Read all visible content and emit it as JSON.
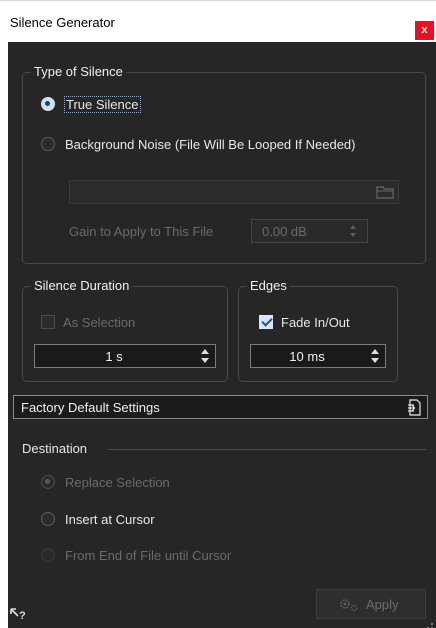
{
  "window": {
    "title": "Silence Generator",
    "close_label": "x"
  },
  "type_of_silence": {
    "legend": "Type of Silence",
    "true_silence": "True Silence",
    "background_noise": "Background Noise (File Will Be Looped If Needed)",
    "file_path": "",
    "gain_label": "Gain to Apply to This File",
    "gain_value": "0.00 dB"
  },
  "silence_duration": {
    "legend": "Silence Duration",
    "as_selection": "As Selection",
    "value": "1 s"
  },
  "edges": {
    "legend": "Edges",
    "fade_label": "Fade In/Out",
    "value": "10 ms"
  },
  "presets": {
    "label": "Factory Default Settings"
  },
  "destination": {
    "label": "Destination",
    "replace": "Replace Selection",
    "insert": "Insert at Cursor",
    "from_end": "From End of File until Cursor"
  },
  "footer": {
    "help_glyph": "?",
    "apply_label": "Apply"
  }
}
